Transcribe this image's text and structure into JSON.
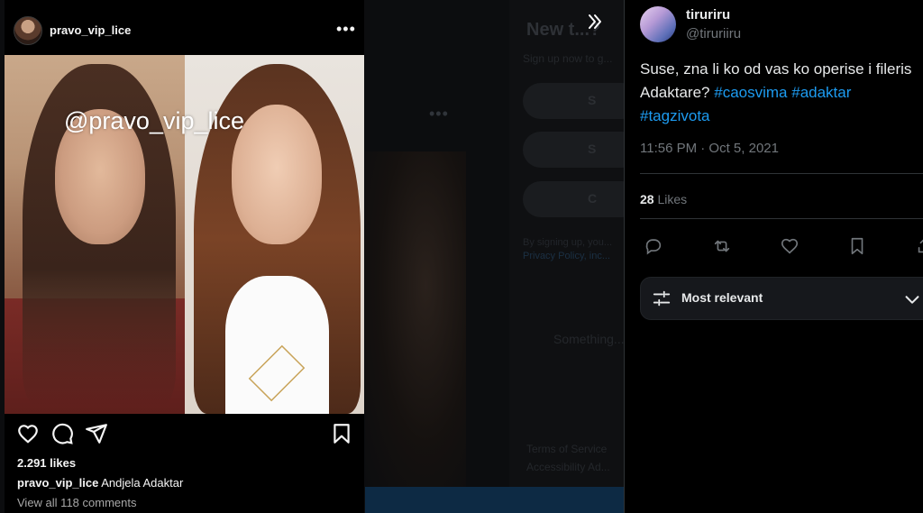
{
  "background_page": {
    "title": "New t...?",
    "subtitle": "Sign up now to g...",
    "signup_buttons": [
      "S",
      "S",
      "C"
    ],
    "terms_text": "By signing up, you...",
    "terms_link": "Privacy Policy, inc...",
    "something_text": "Something...",
    "footer_links": [
      "Terms of Service",
      "Accessibility   Ad..."
    ]
  },
  "instagram_post": {
    "username": "pravo_vip_lice",
    "watermark": "@pravo_vip_lice",
    "likes": "2.291 likes",
    "caption_user": "pravo_vip_lice",
    "caption_text": "Andjela Adaktar",
    "comments_link": "View all 118 comments",
    "icons": [
      "heart-icon",
      "comment-icon",
      "share-icon",
      "bookmark-icon",
      "more-icon"
    ]
  },
  "tweet": {
    "display_name": "tiruriru",
    "handle": "@tiruriiru",
    "text_line1": "Suse, zna li ko od vas ko operise i fileris",
    "text_line2_plain": "Adaktare? ",
    "hashtags": [
      "#caosvima",
      "#adaktar",
      "#tagzivota"
    ],
    "timestamp": "11:56 PM · Oct 5, 2021",
    "likes_count": "28",
    "likes_label": "Likes",
    "sort_label": "Most relevant",
    "action_icons": [
      "reply-icon",
      "retweet-icon",
      "like-icon",
      "bookmark-icon",
      "share-icon"
    ]
  },
  "colors": {
    "accent": "#1d9bf0",
    "text_primary": "#e7e9ea",
    "text_secondary": "#71767b"
  }
}
